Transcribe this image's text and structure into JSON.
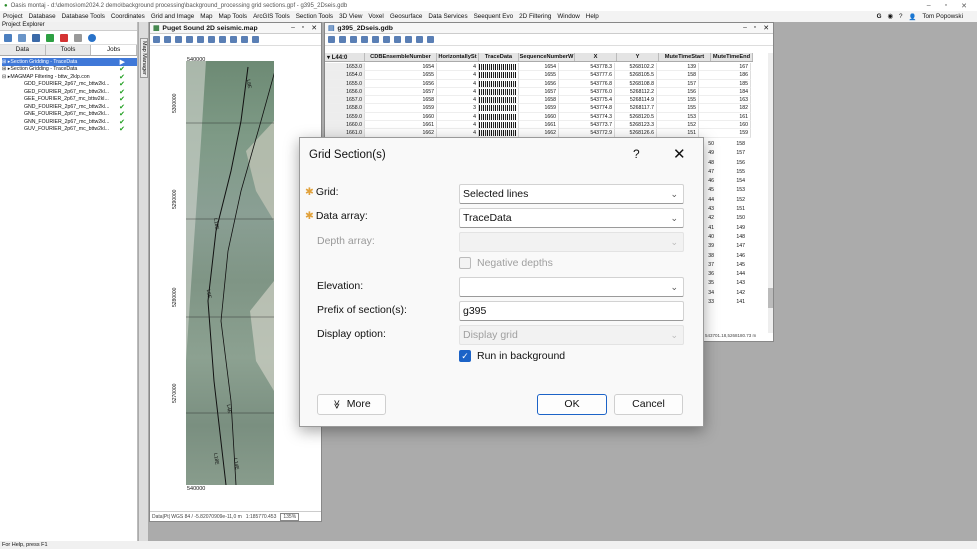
{
  "app": {
    "title": "Oasis montaj - d:\\demos\\om2024.2 demo\\background processing\\background_processing grid sections.gpf - g395_2Dseis.gdb"
  },
  "menu": [
    "Project",
    "Database",
    "Database Tools",
    "Coordinates",
    "Grid and Image",
    "Map",
    "Map Tools",
    "ArcGIS Tools",
    "Section Tools",
    "3D View",
    "Voxel",
    "Geosurface",
    "Data Services",
    "Seequent Evo",
    "2D Filtering",
    "Window",
    "Help"
  ],
  "user": {
    "name": "Tom Popowski"
  },
  "explorer": {
    "title": "Project Explorer",
    "tabs": [
      "Data",
      "Tools",
      "Jobs"
    ],
    "items": [
      {
        "label": "Section Gridding - TraceData",
        "state": "active"
      },
      {
        "label": "Section Gridding - TraceData",
        "state": "done"
      },
      {
        "label": "MAGMAP Filtering - bttw_2klp.con",
        "state": "done"
      },
      {
        "label": "GDD_FOURIER_2p67_mc_bttw2kl...",
        "state": "done"
      },
      {
        "label": "GED_FOURIER_2p67_mc_bttw2kl...",
        "state": "done"
      },
      {
        "label": "GEE_FOURIER_2p67_mc_bttw2kl...",
        "state": "done"
      },
      {
        "label": "GND_FOURIER_2p67_mc_bttw2kl...",
        "state": "done"
      },
      {
        "label": "GNE_FOURIER_2p67_mc_bttw2kl...",
        "state": "done"
      },
      {
        "label": "GNN_FOURIER_2p67_mc_bttw2kl...",
        "state": "done"
      },
      {
        "label": "GUV_FOURIER_2p67_mc_bttw2kl...",
        "state": "done"
      }
    ]
  },
  "side_tab": "Map Manager",
  "map": {
    "title": "Puget Sound 2D seismic.map",
    "x_top": "540000",
    "x_bottom": "540000",
    "y_labels": [
      "5300000",
      "5290000",
      "5280000",
      "5270000"
    ],
    "line_labels": [
      "L8E",
      "L18E",
      "L6E",
      "L4E",
      "L18E",
      "L14E"
    ],
    "status": "Data|Pt| WGS 84 / -5.82070909e-11,0 m",
    "scale": "1:185770.453",
    "zoom": "135%"
  },
  "db": {
    "title": "g395_2Dseis.gdb",
    "line": "L44:0",
    "columns": [
      "CDBEnsembleNumber",
      "HorizontallySt",
      "TraceData",
      "SequenceNumberW",
      "X",
      "Y",
      "MuteTimeStart",
      "MuteTimeEnd"
    ],
    "rows": [
      [
        "1653.0",
        "1654",
        "4",
        "1654",
        "543778.3",
        "5268102.2",
        "139",
        "167"
      ],
      [
        "1654.0",
        "1655",
        "4",
        "1655",
        "543777.6",
        "5268105.5",
        "158",
        "186"
      ],
      [
        "1655.0",
        "1656",
        "4",
        "1656",
        "543776.8",
        "5268108.8",
        "157",
        "185"
      ],
      [
        "1656.0",
        "1657",
        "4",
        "1657",
        "543776.0",
        "5268112.2",
        "156",
        "184"
      ],
      [
        "1657.0",
        "1658",
        "4",
        "1658",
        "543775.4",
        "5268114.9",
        "155",
        "163"
      ],
      [
        "1658.0",
        "1659",
        "3",
        "1659",
        "543774.8",
        "5268117.7",
        "155",
        "182"
      ],
      [
        "1659.0",
        "1660",
        "4",
        "1660",
        "543774.3",
        "5268120.5",
        "153",
        "161"
      ],
      [
        "1660.0",
        "1661",
        "4",
        "1661",
        "543773.7",
        "5268123.3",
        "152",
        "160"
      ],
      [
        "1661.0",
        "1662",
        "4",
        "1662",
        "543772.9",
        "5268126.6",
        "151",
        "159"
      ]
    ],
    "more_end": [
      "158",
      "157",
      "156",
      "155",
      "154",
      "153",
      "152",
      "151",
      "150",
      "149",
      "148",
      "147",
      "146",
      "145",
      "144",
      "143",
      "142",
      "141"
    ],
    "more_start": [
      "50",
      "49",
      "48",
      "47",
      "46",
      "45",
      "44",
      "43",
      "42",
      "41",
      "40",
      "39",
      "38",
      "37",
      "36",
      "35",
      "34",
      "33"
    ],
    "status": "543701.18,5268180.73 m"
  },
  "dialog": {
    "title": "Grid Section(s)",
    "help": "?",
    "close": "✕",
    "grid": {
      "label": "Grid:",
      "value": "Selected lines"
    },
    "data_array": {
      "label": "Data array:",
      "value": "TraceData"
    },
    "depth_array": {
      "label": "Depth array:",
      "value": ""
    },
    "negative_depths": {
      "label": "Negative depths",
      "checked": false
    },
    "elevation": {
      "label": "Elevation:",
      "value": ""
    },
    "prefix": {
      "label": "Prefix of section(s):",
      "value": "g395"
    },
    "display_option": {
      "label": "Display option:",
      "value": "Display grid"
    },
    "run_bg": {
      "label": "Run in background",
      "checked": true
    },
    "more_btn": "More",
    "more_icon": "≫",
    "ok_btn": "OK",
    "cancel_btn": "Cancel"
  },
  "status_bar": "For Help, press F1"
}
